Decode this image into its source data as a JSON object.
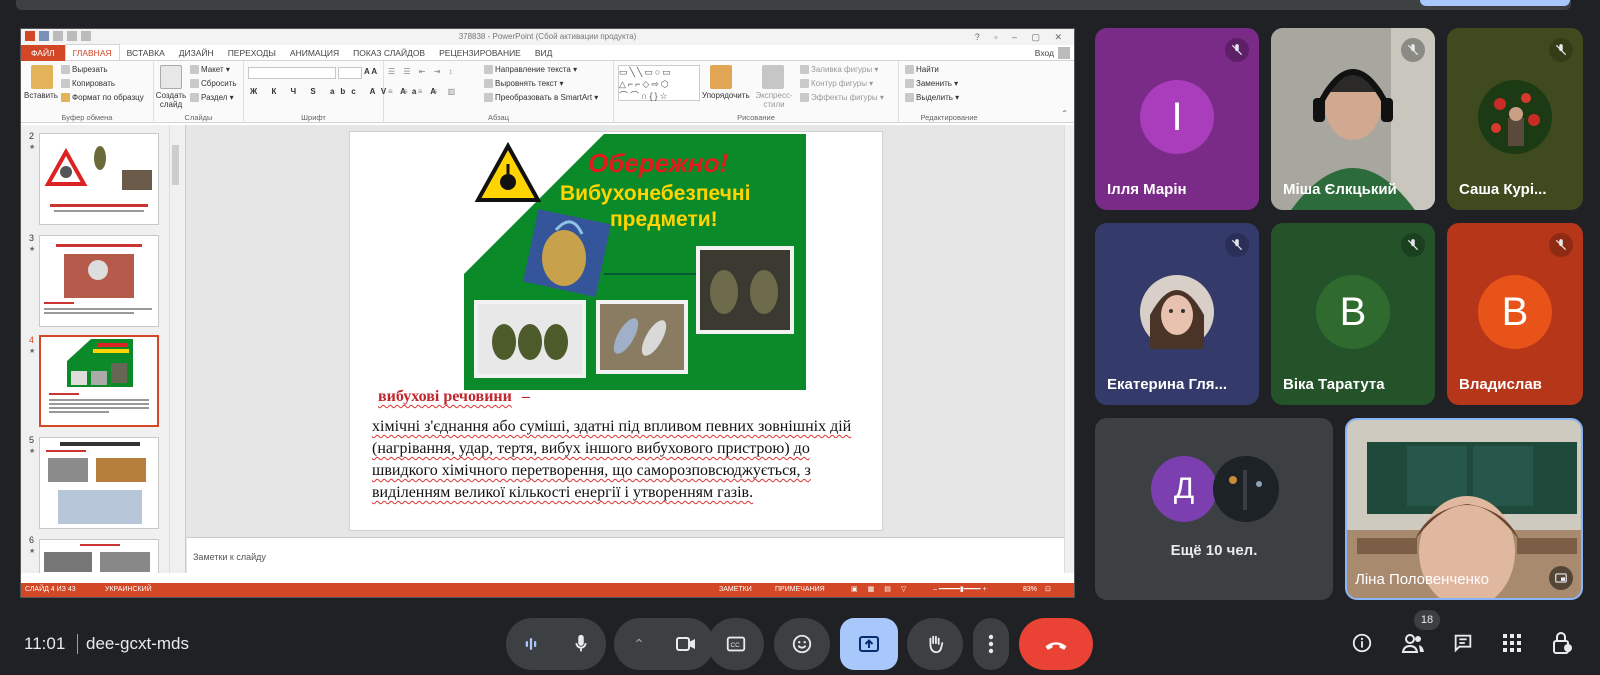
{
  "powerpoint": {
    "title": "378838 - PowerPoint (Сбой активации продукта)",
    "login": "Вход",
    "tabs": [
      "ФАЙЛ",
      "ГЛАВНАЯ",
      "ВСТАВКА",
      "ДИЗАЙН",
      "ПЕРЕХОДЫ",
      "АНИМАЦИЯ",
      "ПОКАЗ СЛАЙДОВ",
      "РЕЦЕНЗИРОВАНИЕ",
      "ВИД"
    ],
    "ribbon": {
      "paste": "Вставить",
      "cut": "Вырезать",
      "copy": "Копировать",
      "format_painter": "Формат по образцу",
      "clipboard_group": "Буфер обмена",
      "new_slide": "Создать слайд",
      "layout": "Макет",
      "reset": "Сбросить",
      "section": "Раздел",
      "slides_group": "Слайды",
      "font_group": "Шрифт",
      "text_direction": "Направление текста",
      "align_text": "Выровнять текст",
      "convert_smartart": "Преобразовать в SmartArt",
      "paragraph_group": "Абзац",
      "arrange": "Упорядочить",
      "quick_styles": "Экспресс-стили",
      "shape_fill": "Заливка фигуры",
      "shape_outline": "Контур фигуры",
      "shape_effects": "Эффекты фигуры",
      "drawing_group": "Рисование",
      "find": "Найти",
      "replace": "Заменить",
      "select": "Выделить",
      "editing_group": "Редактирование"
    },
    "thumbnails": [
      {
        "num": "2",
        "caption": "Від вибухонебезпечних предметів слід рятуватись бігом..."
      },
      {
        "num": "3",
        "caption": "До вибухонебезпечних предметів належать"
      },
      {
        "num": "4",
        "caption": "Обережно! Вибухонебезпечні предмети!"
      },
      {
        "num": "5",
        "caption": "До боєприпасів належать:"
      },
      {
        "num": "6",
        "caption": ""
      }
    ],
    "slide": {
      "poster_line1": "Обережно!",
      "poster_line2": "Вибухонебезпечні",
      "poster_line3": "предмети!",
      "heading": "вибухові речовини",
      "dash": " –",
      "body": "хімічні з'єднання або суміші, здатні під впливом певних зовнішніх дій (нагрівання, удар, тертя, вибух іншого вибухового пристрою) до швидкого хімічного перетворення, що саморозповсюджується, з виділенням великої кількості енергії і утворенням газів."
    },
    "notes_placeholder": "Заметки к слайду",
    "status": {
      "slide": "СЛАЙД 4 ИЗ 43",
      "language": "УКРАИНСКИЙ",
      "notes": "ЗАМЕТКИ",
      "comments": "ПРИМЕЧАНИЯ",
      "zoom": "83%"
    }
  },
  "participants": [
    {
      "name": "Ілля Марін",
      "initial": "I",
      "muted": true
    },
    {
      "name": "Міша Єлкцький",
      "muted": true
    },
    {
      "name": "Саша Курі...",
      "muted": true
    },
    {
      "name": "Екатерина Гля...",
      "muted": true
    },
    {
      "name": "Віка Таратута",
      "initial": "В",
      "muted": true
    },
    {
      "name": "Владислав",
      "initial": "В",
      "muted": true
    },
    {
      "name": "Ліна Половенченко"
    }
  ],
  "others": {
    "initial": "Д",
    "label": "Ещё 10 чел."
  },
  "meeting": {
    "time": "11:01",
    "code": "dee-gcxt-mds",
    "participant_count": "18"
  },
  "colors": {
    "accent_orange": "#d24726",
    "leave_red": "#ea4335",
    "present_blue": "#a8c7fa",
    "tile_purple": "#9a3ba2",
    "tile_green": "#2f6b2f",
    "tile_orange": "#e8531a"
  }
}
